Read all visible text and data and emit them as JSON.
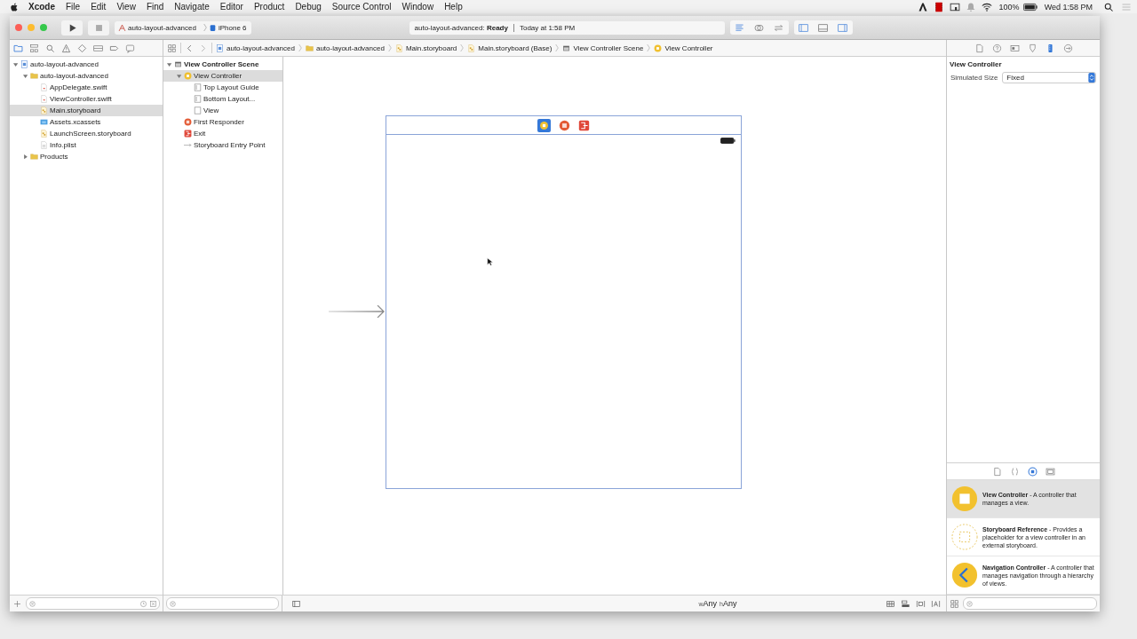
{
  "menu_bar": {
    "app": "Xcode",
    "items": [
      "File",
      "Edit",
      "View",
      "Find",
      "Navigate",
      "Editor",
      "Product",
      "Debug",
      "Source Control",
      "Window",
      "Help"
    ],
    "battery": "100%",
    "clock": "Wed 1:58 PM"
  },
  "toolbar": {
    "scheme": "auto-layout-advanced",
    "device": "iPhone 6",
    "status": "auto-layout-advanced: **Ready**",
    "time": "Today at 1:58 PM",
    "editor_modes": [
      {
        "kind": "standard",
        "selected": true
      },
      {
        "kind": "assistant",
        "selected": false
      },
      {
        "kind": "version",
        "selected": false
      }
    ],
    "panels": [
      {
        "kind": "left",
        "on": true
      },
      {
        "kind": "bottom",
        "on": false
      },
      {
        "kind": "right",
        "on": true
      }
    ]
  },
  "navigator": {
    "tabs": [
      {
        "kind": "folder",
        "selected": true
      },
      {
        "kind": "hierarchy",
        "selected": false
      },
      {
        "kind": "search",
        "selected": false
      },
      {
        "kind": "warning",
        "selected": false
      },
      {
        "kind": "test",
        "selected": false
      },
      {
        "kind": "debug",
        "selected": false
      },
      {
        "kind": "breakpoint",
        "selected": false
      },
      {
        "kind": "report",
        "selected": false
      }
    ],
    "tree": [
      {
        "label": "auto-layout-advanced",
        "kind": "project",
        "expanded": true,
        "selected": false,
        "children": [
          {
            "label": "auto-layout-advanced",
            "kind": "folder",
            "expanded": true,
            "selected": false,
            "children": [
              {
                "label": "AppDelegate.swift",
                "kind": "swift",
                "selected": false
              },
              {
                "label": "ViewController.swift",
                "kind": "swift",
                "selected": false
              },
              {
                "label": "Main.storyboard",
                "kind": "storyboard",
                "selected": true
              },
              {
                "label": "Assets.xcassets",
                "kind": "assets",
                "selected": false
              },
              {
                "label": "LaunchScreen.storyboard",
                "kind": "storyboard",
                "selected": false
              },
              {
                "label": "Info.plist",
                "kind": "plist",
                "selected": false
              }
            ]
          },
          {
            "label": "Products",
            "kind": "folder",
            "expanded": false,
            "selected": false
          }
        ]
      }
    ]
  },
  "jump_bar": [
    {
      "label": "auto-layout-advanced",
      "kind": "project"
    },
    {
      "label": "auto-layout-advanced",
      "kind": "folder"
    },
    {
      "label": "Main.storyboard",
      "kind": "storyboard"
    },
    {
      "label": "Main.storyboard (Base)",
      "kind": "storyboard"
    },
    {
      "label": "View Controller Scene",
      "kind": "scene"
    },
    {
      "label": "View Controller",
      "kind": "controller"
    }
  ],
  "outline": [
    {
      "label": "View Controller Scene",
      "kind": "scene",
      "expanded": true,
      "selected": false,
      "children": [
        {
          "label": "View Controller",
          "kind": "controller",
          "expanded": true,
          "selected": true,
          "children": [
            {
              "label": "Top Layout Guide",
              "kind": "guide",
              "selected": false
            },
            {
              "label": "Bottom Layout...",
              "kind": "guide",
              "selected": false
            },
            {
              "label": "View",
              "kind": "view",
              "selected": false
            }
          ]
        },
        {
          "label": "First Responder",
          "kind": "responder",
          "selected": false
        },
        {
          "label": "Exit",
          "kind": "exit",
          "selected": false
        },
        {
          "label": "Storyboard Entry Point",
          "kind": "entry",
          "selected": false
        }
      ]
    }
  ],
  "size_class": [
    {
      "prefix": "w",
      "value": "Any"
    },
    {
      "prefix": "h",
      "value": "Any"
    }
  ],
  "inspector": {
    "tabs": [
      {
        "kind": "file",
        "selected": false
      },
      {
        "kind": "help",
        "selected": false
      },
      {
        "kind": "identity",
        "selected": false
      },
      {
        "kind": "attributes",
        "selected": false
      },
      {
        "kind": "size",
        "selected": true
      },
      {
        "kind": "connections",
        "selected": false
      }
    ],
    "title": "View Controller",
    "fields": [
      {
        "label": "Simulated Size",
        "value": "Fixed"
      }
    ]
  },
  "library": {
    "tabs": [
      {
        "kind": "file",
        "selected": false
      },
      {
        "kind": "code",
        "selected": false
      },
      {
        "kind": "object",
        "selected": true
      },
      {
        "kind": "media",
        "selected": false
      }
    ],
    "items": [
      {
        "kind": "controller",
        "text": "**View Controller** - A controller that manages a view.",
        "selected": true
      },
      {
        "kind": "reference",
        "text": "**Storyboard Reference** - Provides a placeholder for a view controller in an external storyboard.",
        "selected": false
      },
      {
        "kind": "navigation",
        "text": "**Navigation Controller** - A controller that manages navigation through a hierarchy of views.",
        "selected": false
      }
    ]
  }
}
